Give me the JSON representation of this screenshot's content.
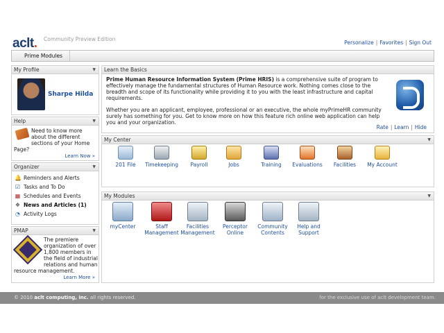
{
  "header": {
    "logo_text": "aclt",
    "logo_dot": ".",
    "edition": "Community Preview Edition",
    "links": [
      "Personalize",
      "Favorites",
      "Sign Out"
    ],
    "separator": "|"
  },
  "module_bar": {
    "tab_label": "Prime Modules"
  },
  "profile": {
    "title": "My Profile",
    "name": "Sharpe Hilda"
  },
  "help": {
    "title": "Help",
    "text": "Need to know more about the different sections of your Home",
    "text2": "Page?",
    "more": "Learn Now »"
  },
  "organizer": {
    "title": "Organizer",
    "items": [
      {
        "label": "Reminders and Alerts",
        "icon": "bell-icon",
        "glyph": "🔔"
      },
      {
        "label": "Tasks and To Do",
        "icon": "checkbox-icon",
        "glyph": "☑"
      },
      {
        "label": "Schedules and Events",
        "icon": "calendar-icon",
        "glyph": "▦"
      },
      {
        "label": "News and Articles (1)",
        "icon": "news-icon",
        "glyph": "❖"
      },
      {
        "label": "Activity Logs",
        "icon": "log-icon",
        "glyph": "◔"
      }
    ]
  },
  "pmap": {
    "title": "PMAP",
    "text": "The premiere organization of over 1,800 members in the field of industrial relations and human",
    "text2": "resource management.",
    "more": "Learn More »"
  },
  "basics": {
    "title": "Learn the Basics",
    "heading": "Prime Human Resource Information System (Prime HRIS)",
    "para1_rest": " is a comprehensive suite of program to effectively manage the fundamental structures of Human Resource work. Nothing comes close to the breadth and scope of its functionality while providing it to you with the least infrastructure and capital requirements.",
    "para2": "Whether you are an applicant, employee, professional or an executive, the whole myPrimeHR community surely has something for you. Get to know more on how this feature rich online web application can help you and your organization.",
    "links": [
      "Rate",
      "Learn",
      "Hide"
    ]
  },
  "center": {
    "title": "My Center",
    "items": [
      "201 File",
      "Timekeeping",
      "Payroll",
      "Jobs",
      "Training",
      "Evaluations",
      "Facilities",
      "My Account"
    ]
  },
  "modules": {
    "title": "My Modules",
    "items": [
      "myCenter",
      "Staff Management",
      "Facilities Management",
      "Perceptor Online",
      "Community Contents",
      "Help and Support"
    ]
  },
  "footer": {
    "left_prefix": "© 2010 ",
    "left_bold": "aclt computing, inc.",
    "left_suffix": " all rights reserved.",
    "right": "for the exclusive use of aclt development team."
  },
  "colors": {
    "link": "#1f4fa0",
    "footer": "#8a8a8a",
    "logo": "#1d3f72",
    "accent": "#d94a1e"
  }
}
